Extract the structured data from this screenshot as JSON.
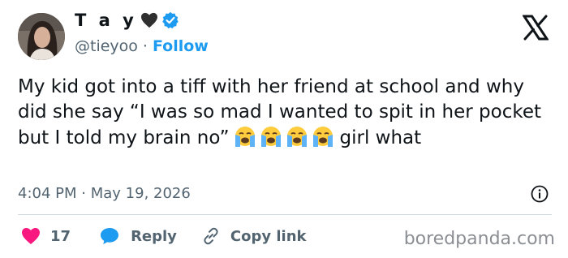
{
  "header": {
    "display_name": "T a y",
    "handle": "@tieyoo",
    "separator": "·",
    "follow_label": "Follow"
  },
  "tweet": {
    "text_part1": "My kid got into a tiff with her friend at school and why did she say “I was so mad I wanted to spit in her pocket but I told my brain no”",
    "text_part2": "girl what",
    "emoji_count": 4
  },
  "meta": {
    "time": "4:04 PM",
    "separator": "·",
    "date": "May 19, 2026"
  },
  "actions": {
    "like_count": "17",
    "reply_label": "Reply",
    "copy_label": "Copy link"
  },
  "watermark": "boredpanda.com",
  "colors": {
    "heart": "#f91880",
    "reply_bubble": "#1d9bf0",
    "verified": "#1d9bf0",
    "link": "#1d9bf0",
    "secondary_text": "#536471"
  },
  "icons": [
    "avatar",
    "black-heart-icon",
    "verified-badge-icon",
    "x-logo-icon",
    "loudly-crying-face-emoji",
    "info-icon",
    "heart-icon",
    "reply-bubble-icon",
    "link-icon"
  ]
}
